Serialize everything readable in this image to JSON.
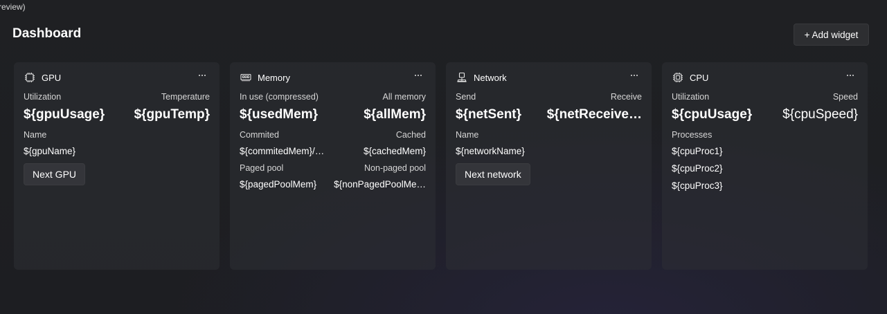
{
  "window": {
    "title_fragment": "review)"
  },
  "header": {
    "title": "Dashboard",
    "add_widget_label": "+ Add widget"
  },
  "widgets": {
    "gpu": {
      "title": "GPU",
      "icon": "chip-icon",
      "utilization_label": "Utilization",
      "utilization_value": "${gpuUsage}",
      "temperature_label": "Temperature",
      "temperature_value": "${gpuTemp}",
      "name_label": "Name",
      "name_value": "${gpuName}",
      "next_button": "Next GPU"
    },
    "memory": {
      "title": "Memory",
      "icon": "memory-icon",
      "inuse_label": "In use (compressed)",
      "inuse_value": "${usedMem}",
      "all_label": "All memory",
      "all_value": "${allMem}",
      "committed_label": "Commited",
      "committed_value": "${commitedMem}/…",
      "cached_label": "Cached",
      "cached_value": "${cachedMem}",
      "paged_label": "Paged pool",
      "paged_value": "${pagedPoolMem}",
      "nonpaged_label": "Non-paged pool",
      "nonpaged_value": "${nonPagedPoolMe…"
    },
    "network": {
      "title": "Network",
      "icon": "network-icon",
      "send_label": "Send",
      "send_value": "${netSent}",
      "receive_label": "Receive",
      "receive_value": "${netReceive…",
      "name_label": "Name",
      "name_value": "${networkName}",
      "next_button": "Next network"
    },
    "cpu": {
      "title": "CPU",
      "icon": "cpu-icon",
      "utilization_label": "Utilization",
      "utilization_value": "${cpuUsage}",
      "speed_label": "Speed",
      "speed_value": "${cpuSpeed}",
      "processes_label": "Processes",
      "processes": [
        "${cpuProc1}",
        "${cpuProc2}",
        "${cpuProc3}"
      ]
    }
  }
}
